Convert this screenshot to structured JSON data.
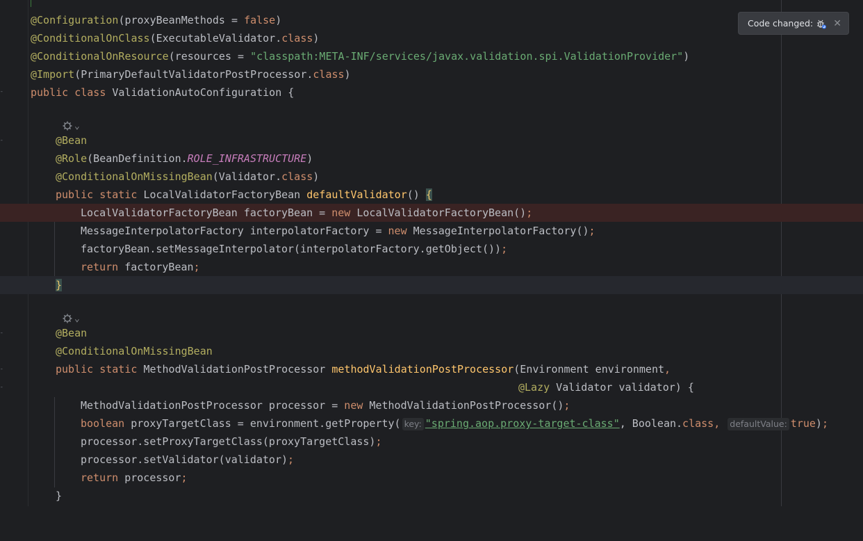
{
  "notification": {
    "text": "Code changed:",
    "status_icon": "bug-reload-icon",
    "close_icon": "close-icon"
  },
  "hints": {
    "key": "key:",
    "default_value": "defaultValue:"
  },
  "code": {
    "l1": {
      "ann": "@Configuration",
      "a": "(proxyBeanMethods = ",
      "kw": "false",
      "b": ")"
    },
    "l2": {
      "ann": "@ConditionalOnClass",
      "a": "(ExecutableValidator.",
      "kw": "class",
      "b": ")"
    },
    "l3": {
      "ann": "@ConditionalOnResource",
      "a": "(resources = ",
      "str": "\"classpath:META-INF/services/javax.validation.spi.ValidationProvider\"",
      "b": ")"
    },
    "l4": {
      "ann": "@Import",
      "a": "(PrimaryDefaultValidatorPostProcessor.",
      "kw": "class",
      "b": ")"
    },
    "l5": {
      "kw1": "public",
      "kw2": "class",
      "a": "ValidationAutoConfiguration {"
    },
    "l6": {
      "ann": "@Bean"
    },
    "l7": {
      "ann": "@Role",
      "a": "(BeanDefinition.",
      "const": "ROLE_INFRASTRUCTURE",
      "b": ")"
    },
    "l8": {
      "ann": "@ConditionalOnMissingBean",
      "a": "(Validator.",
      "kw": "class",
      "b": ")"
    },
    "l9": {
      "kw1": "public",
      "kw2": "static",
      "a": "LocalValidatorFactoryBean ",
      "decl": "defaultValidator",
      "b": "() ",
      "brace": "{"
    },
    "l10": {
      "a": "LocalValidatorFactoryBean factoryBean = ",
      "kw": "new",
      "b": " LocalValidatorFactoryBean()",
      "semi": ";"
    },
    "l11": {
      "a": "MessageInterpolatorFactory interpolatorFactory = ",
      "kw": "new",
      "b": " MessageInterpolatorFactory()",
      "semi": ";"
    },
    "l12": {
      "a": "factoryBean.setMessageInterpolator(interpolatorFactory.getObject())",
      "semi": ";"
    },
    "l13": {
      "kw": "return",
      "a": " factoryBean",
      "semi": ";"
    },
    "l14": {
      "brace": "}"
    },
    "l15": {
      "ann": "@Bean"
    },
    "l16": {
      "ann": "@ConditionalOnMissingBean"
    },
    "l17": {
      "kw1": "public",
      "kw2": "static",
      "a": "MethodValidationPostProcessor ",
      "decl": "methodValidationPostProcessor",
      "b": "(Environment environment",
      "comma": ","
    },
    "l18": {
      "ann": "@Lazy",
      "a": " Validator validator) {"
    },
    "l19": {
      "a": "MethodValidationPostProcessor processor = ",
      "kw": "new",
      "b": " MethodValidationPostProcessor()",
      "semi": ";"
    },
    "l20": {
      "kw": "boolean",
      "a": " proxyTargetClass = environment.getProperty(",
      "str": "\"spring.aop.proxy-target-class\"",
      "b": ", Boolean.",
      "kw2": "class",
      "comma": ",",
      "kw3": "true",
      "c": ")",
      "semi": ";"
    },
    "l21": {
      "a": "processor.setProxyTargetClass(proxyTargetClass)",
      "semi": ";"
    },
    "l22": {
      "a": "processor.setValidator(validator)",
      "semi": ";"
    },
    "l23": {
      "kw": "return",
      "a": " processor",
      "semi": ";"
    },
    "l24": {
      "brace": "}"
    }
  },
  "colors": {
    "background": "#1e1f22",
    "annotation": "#b3ae60",
    "keyword": "#cf8e6d",
    "string": "#6aab73",
    "declaration": "#ffc66d",
    "constant": "#c77dbb",
    "breakpoint_line": "#3a2323"
  }
}
